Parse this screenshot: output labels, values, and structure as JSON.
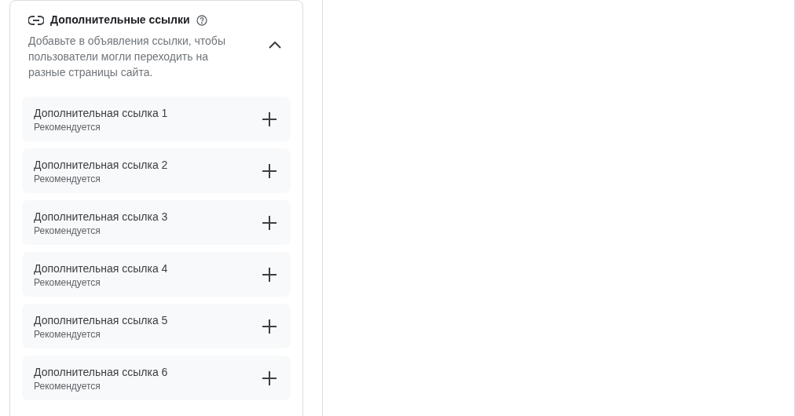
{
  "section": {
    "title": "Дополнительные ссылки",
    "description": "Добавьте в объявления ссылки, чтобы пользователи могли переходить на разные страницы сайта.",
    "expanded": true
  },
  "links": [
    {
      "title": "Дополнительная ссылка 1",
      "note": "Рекомендуется"
    },
    {
      "title": "Дополнительная ссылка 2",
      "note": "Рекомендуется"
    },
    {
      "title": "Дополнительная ссылка 3",
      "note": "Рекомендуется"
    },
    {
      "title": "Дополнительная ссылка 4",
      "note": "Рекомендуется"
    },
    {
      "title": "Дополнительная ссылка 5",
      "note": "Рекомендуется"
    },
    {
      "title": "Дополнительная ссылка 6",
      "note": "Рекомендуется"
    }
  ]
}
